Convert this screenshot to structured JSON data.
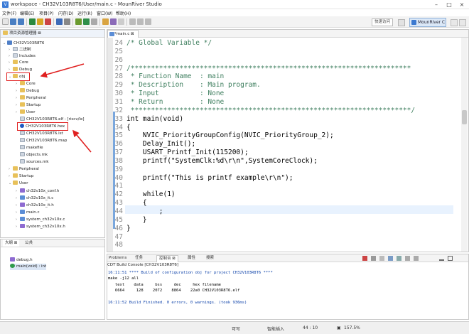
{
  "window": {
    "title": "workspace - CH32V103R8T6/User/main.c - MounRiver Studio"
  },
  "menu": [
    "文件(F)",
    "编辑(E)",
    "项目(P)",
    "闪存(D)",
    "运行(R)",
    "窗口(W)",
    "帮助(H)"
  ],
  "toolbar": {
    "quick_access": "快速访问",
    "perspective": "MounRiver C"
  },
  "explorer": {
    "title": "项目资源管理器",
    "items": [
      "CH32V103R8T6",
      "二进制",
      "Includes",
      "Core",
      "Debug",
      "obj",
      "Core",
      "Debug",
      "Peripheral",
      "Startup",
      "User",
      "CH32V103R8T6.elf - [riscv/le]",
      "CH32V103R8T6.hex",
      "CH32V103R8T6.lst",
      "CH32V103R8T6.map",
      "makefile",
      "objects.mk",
      "sources.mk",
      "Peripheral",
      "Startup",
      "User",
      "ch32v10x_conf.h",
      "ch32v10x_it.c",
      "ch32v10x_it.h",
      "main.c",
      "system_ch32v10x.c",
      "system_ch32v10x.h"
    ]
  },
  "outline": {
    "tab1": "大纲",
    "tab2": "公共",
    "items": [
      "debug.h",
      "main(void) : int"
    ]
  },
  "editor": {
    "tab": "*main.c",
    "lines": [
      [
        "24",
        "/* Global Variable */"
      ],
      [
        "25",
        ""
      ],
      [
        "26",
        ""
      ],
      [
        "27",
        "/*********************************************************************"
      ],
      [
        "28",
        " * Function Name  : main"
      ],
      [
        "29",
        " * Description    : Main program."
      ],
      [
        "30",
        " * Input          : None"
      ],
      [
        "31",
        " * Return         : None"
      ],
      [
        "32",
        " *********************************************************************/"
      ],
      [
        "33",
        "int main(void)"
      ],
      [
        "34",
        "{"
      ],
      [
        "35",
        "    NVIC_PriorityGroupConfig(NVIC_PriorityGroup_2);"
      ],
      [
        "36",
        "    Delay_Init();"
      ],
      [
        "37",
        "    USART_Printf_Init(115200);"
      ],
      [
        "38",
        "    printf(\"SystemClk:%d\\r\\n\",SystemCoreClock);"
      ],
      [
        "39",
        ""
      ],
      [
        "40",
        "    printf(\"This is printf example\\r\\n\");"
      ],
      [
        "41",
        ""
      ],
      [
        "42",
        "    while(1)"
      ],
      [
        "43",
        "    {"
      ],
      [
        "44",
        "        ;"
      ],
      [
        "45",
        "    }"
      ],
      [
        "46",
        "}"
      ],
      [
        "47",
        ""
      ],
      [
        "48",
        ""
      ]
    ]
  },
  "console": {
    "tabs": [
      "Problems",
      "任务",
      "控制台",
      "属性",
      "搜索"
    ],
    "title": "CDT Build Console [CH32V103R8T6]",
    "lines": [
      "16:11:51 **** Build of configuration obj for project CH32V103R8T6 ****",
      "make -j12 all",
      "   text    data     bss     dec     hex filename",
      "   6664     128    2072    8864    22a0 CH32V103R8T6.elf",
      "",
      "16:11:52 Build Finished. 0 errors, 0 warnings. (took 936ms)"
    ]
  },
  "status": {
    "writable": "可写",
    "insert": "智能插入",
    "position": "44 : 10",
    "zoom": "157.5%"
  },
  "colors": {
    "accent": "#3b7bd6",
    "annotation": "#e02020"
  }
}
